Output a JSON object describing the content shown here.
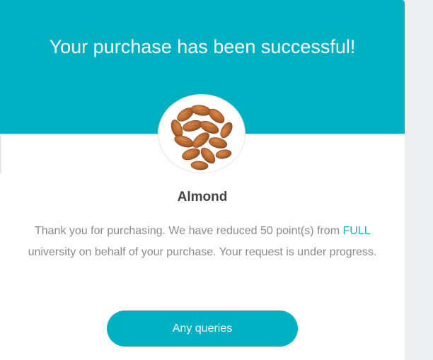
{
  "header": {
    "title": "Your purchase has been successful!"
  },
  "product": {
    "name": "Almond",
    "image_icon": "almond-image"
  },
  "message": {
    "before_link": "Thank you for purchasing. We have reduced 50 point(s) from ",
    "link_text": "FULL",
    "after_link": " university on behalf of your purchase. Your request is under progress."
  },
  "actions": {
    "query_button_label": "Any queries"
  },
  "colors": {
    "header_bg": "#00b1c4",
    "button_bg": "#00b1c4",
    "link": "#1fb3c5",
    "body_text": "#8a8a8a",
    "product_name": "#444444",
    "side_panel": "#eceef0"
  }
}
